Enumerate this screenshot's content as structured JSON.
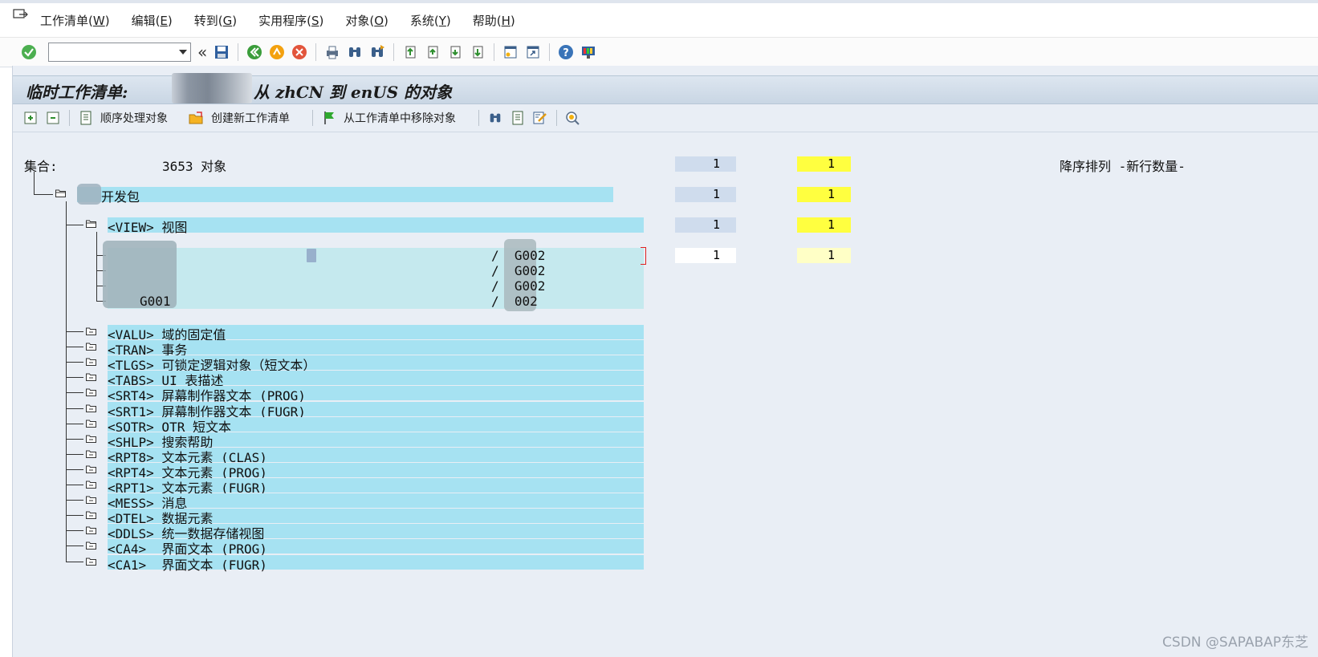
{
  "menubar": {
    "items": [
      "工作清单(W)",
      "编辑(E)",
      "转到(G)",
      "实用程序(S)",
      "对象(O)",
      "系统(Y)",
      "帮助(H)"
    ],
    "underline": [
      "W",
      "E",
      "G",
      "S",
      "O",
      "Y",
      "H"
    ]
  },
  "toolbar": {
    "command_field_value": ""
  },
  "title": {
    "prefix": "临时工作清单:",
    "suffix": "从 zhCN 到 enUS 的对象"
  },
  "app_toolbar": {
    "process_sequential": "顺序处理对象",
    "create_worklist": "创建新工作清单",
    "remove_from_worklist": "从工作清单中移除对象"
  },
  "tree": {
    "collection_label": "集合:",
    "collection_value": "3653 对象",
    "sort_label": "降序排列 -新行数量-",
    "package_label": "开发包",
    "view_label": "<VIEW> 视图",
    "view_rows": [
      {
        "right": "/  G002"
      },
      {
        "right": "/  G002"
      },
      {
        "right": "/  G002"
      },
      {
        "left": "G001",
        "right": "/  002"
      }
    ],
    "types": [
      "<VALU> 域的固定值",
      "<TRAN> 事务",
      "<TLGS> 可锁定逻辑对象（短文本）",
      "<TABS> UI 表描述",
      "<SRT4> 屏幕制作器文本 (PROG)",
      "<SRT1> 屏幕制作器文本 (FUGR)",
      "<SOTR> OTR 短文本",
      "<SHLP> 搜索帮助",
      "<RPT8> 文本元素 (CLAS)",
      "<RPT4> 文本元素 (PROG)",
      "<RPT1> 文本元素 (FUGR)",
      "<MESS> 消息",
      "<DTEL> 数据元素",
      "<DDLS> 统一数据存储视图",
      "<CA4>  界面文本 (PROG)",
      "<CA1>  界面文本 (FUGR)"
    ],
    "counts": [
      {
        "a": "1",
        "b": "1"
      },
      {
        "a": "1",
        "b": "1"
      },
      {
        "a": "1",
        "b": "1"
      },
      {
        "a": "1",
        "b": "1"
      }
    ]
  },
  "watermark": "CSDN @SAPABAP东芝",
  "colors": {
    "row_highlight": "#a6e2f2",
    "count_blue": "#cfdced",
    "count_yellow": "#ffff40",
    "count_light_yellow": "#ffffc6",
    "background": "#e9eef5"
  }
}
